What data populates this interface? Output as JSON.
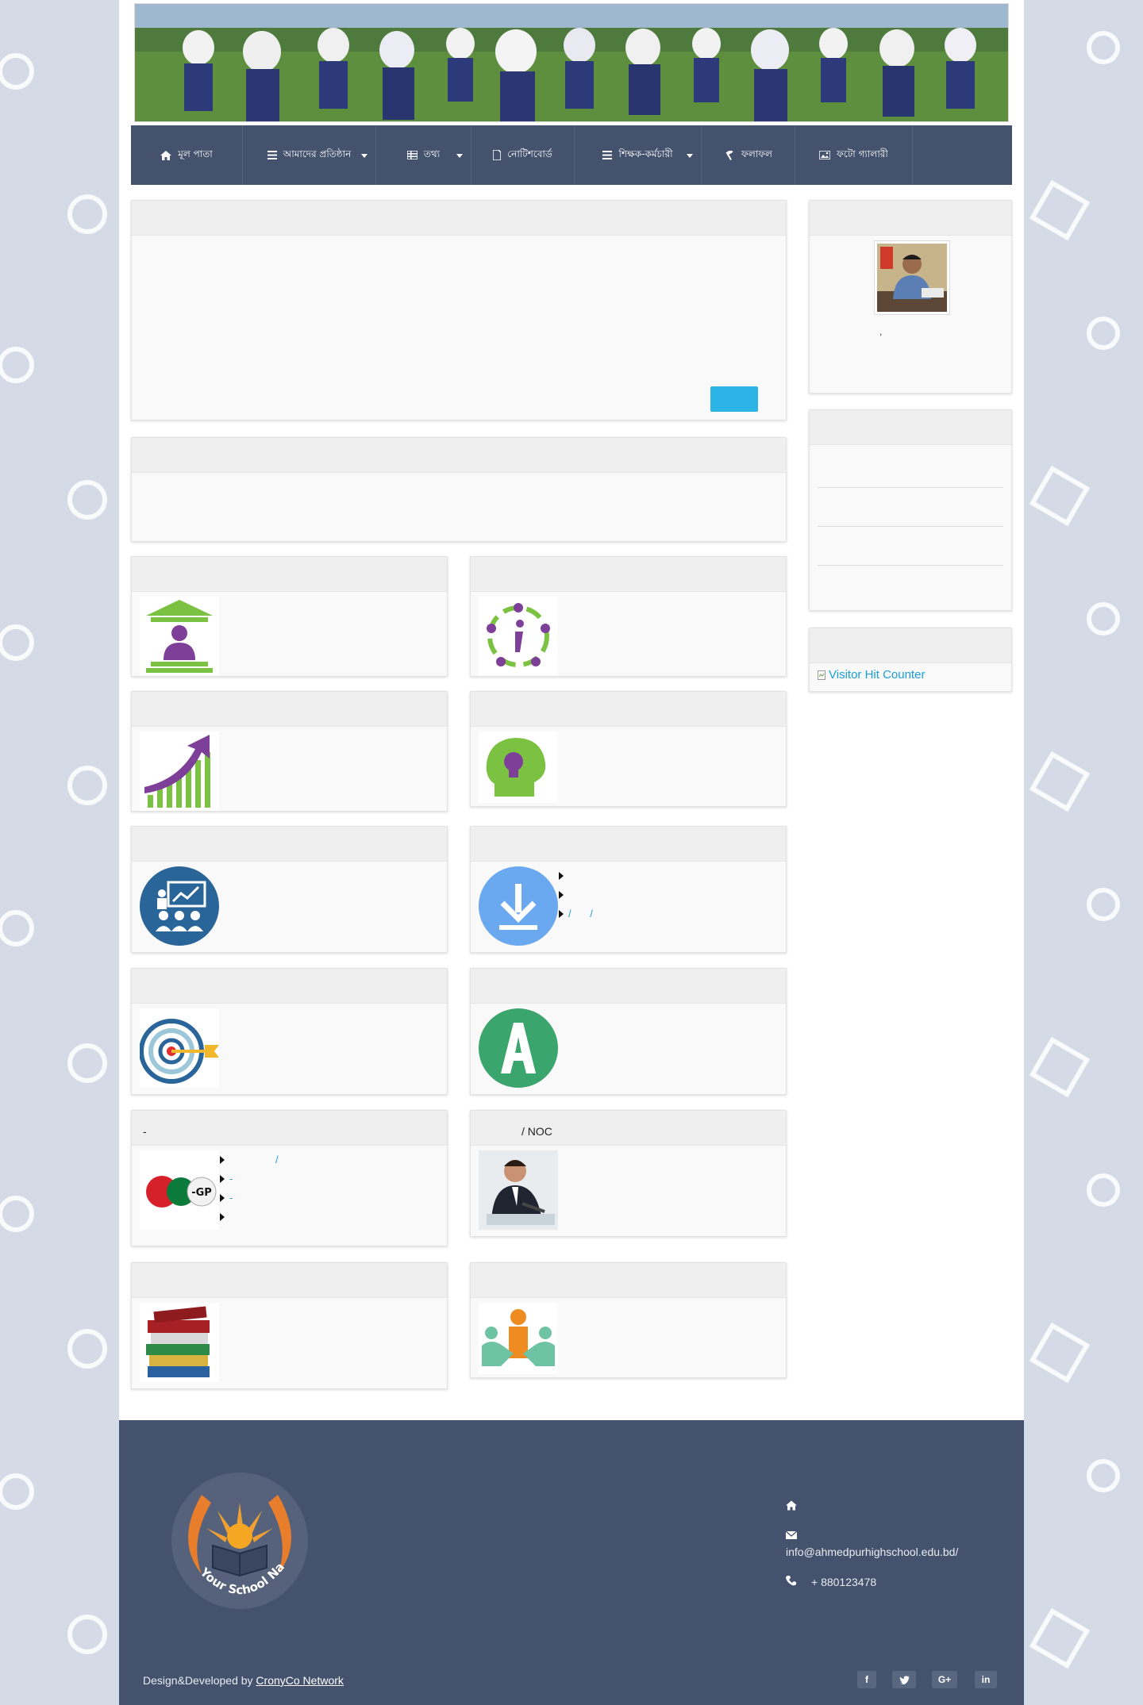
{
  "nav": {
    "items": [
      {
        "label": "মূল পাতা",
        "icon": "home-icon",
        "dropdown": false
      },
      {
        "label": "আমাদের প্রতিষ্ঠান",
        "icon": "list-icon",
        "dropdown": true
      },
      {
        "label": "তথ্য",
        "icon": "table-icon",
        "dropdown": true
      },
      {
        "label": "নোটিশবোর্ড",
        "icon": "document-icon",
        "dropdown": false
      },
      {
        "label": "শিক্ষক-কর্মচারী",
        "icon": "list-icon",
        "dropdown": true
      },
      {
        "label": "ফলাফল",
        "icon": "gavel-icon",
        "dropdown": false
      },
      {
        "label": "ফটো গ্যালারী",
        "icon": "image-icon",
        "dropdown": false
      }
    ]
  },
  "panels": {
    "egp_title": "-",
    "egp_links": [
      "/",
      "-",
      "-",
      ""
    ],
    "noc_title": "/ NOC",
    "download_links": [
      "",
      "",
      "/ /"
    ],
    "principal_caption": ","
  },
  "sidebar": {
    "visitor_counter_alt": "Visitor Hit Counter"
  },
  "footer": {
    "email": "info@ahmedpurhighschool.edu.bd/",
    "phone": "+ 880123478",
    "credit_prefix": "Design&Developed by ",
    "credit_link": "CronyCo Network",
    "logo_text": "Your School Name Here",
    "social": [
      "f",
      "t",
      "G+",
      "in"
    ]
  },
  "colors": {
    "nav_bg": "#45526e",
    "footer_bg": "#45526e",
    "accent": "#2cb4e6",
    "link": "#1a9fd8"
  }
}
